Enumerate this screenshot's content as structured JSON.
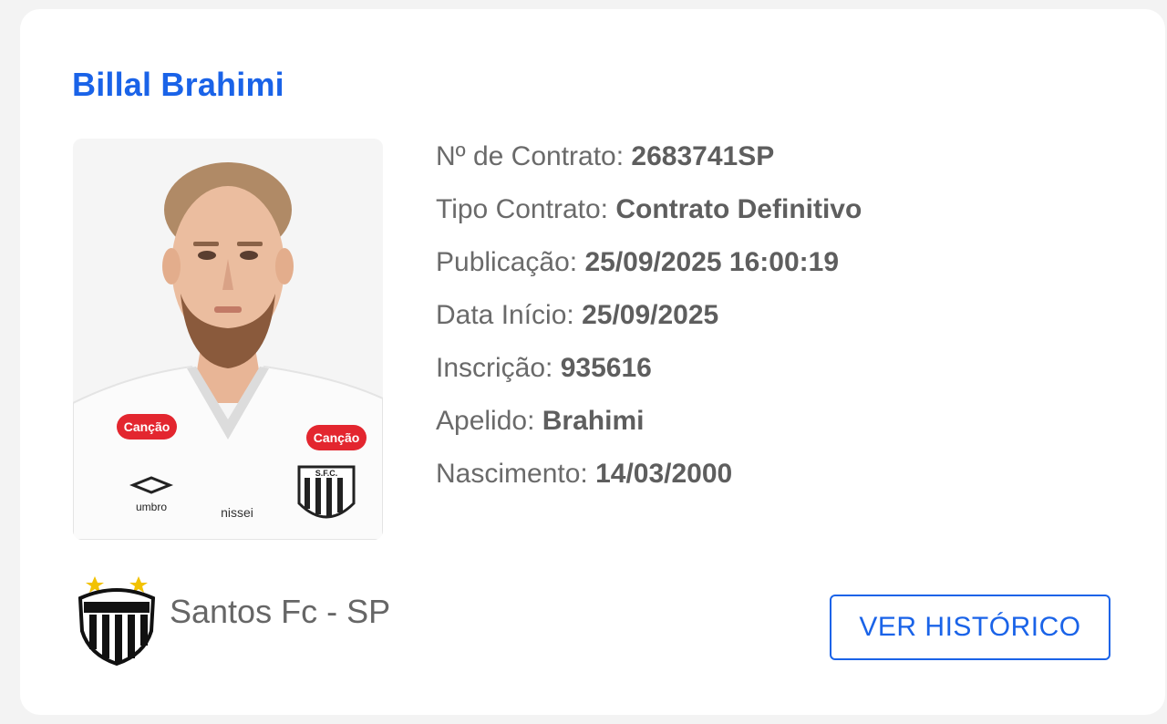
{
  "player": {
    "name": "Billal Brahimi"
  },
  "details": [
    {
      "label": "Nº de Contrato:",
      "value": "2683741SP"
    },
    {
      "label": "Tipo Contrato:",
      "value": "Contrato Definitivo"
    },
    {
      "label": "Publicação:",
      "value": "25/09/2025 16:00:19"
    },
    {
      "label": "Data Início:",
      "value": "25/09/2025"
    },
    {
      "label": "Inscrição:",
      "value": "935616"
    },
    {
      "label": "Apelido:",
      "value": "Brahimi"
    },
    {
      "label": "Nascimento:",
      "value": "14/03/2000"
    }
  ],
  "photo": {
    "icon": "player-photo",
    "sponsor_label": "Canção",
    "brand_label": "umbro",
    "sleeve_label": "nissei",
    "crest_letters": "S.F.C."
  },
  "club": {
    "icon": "santos-crest-icon",
    "name": "Santos Fc - SP"
  },
  "actions": {
    "history_label": "VER HISTÓRICO"
  },
  "colors": {
    "accent": "#1a63e8",
    "text": "#666666",
    "background": "#f3f3f3",
    "card": "#ffffff"
  }
}
